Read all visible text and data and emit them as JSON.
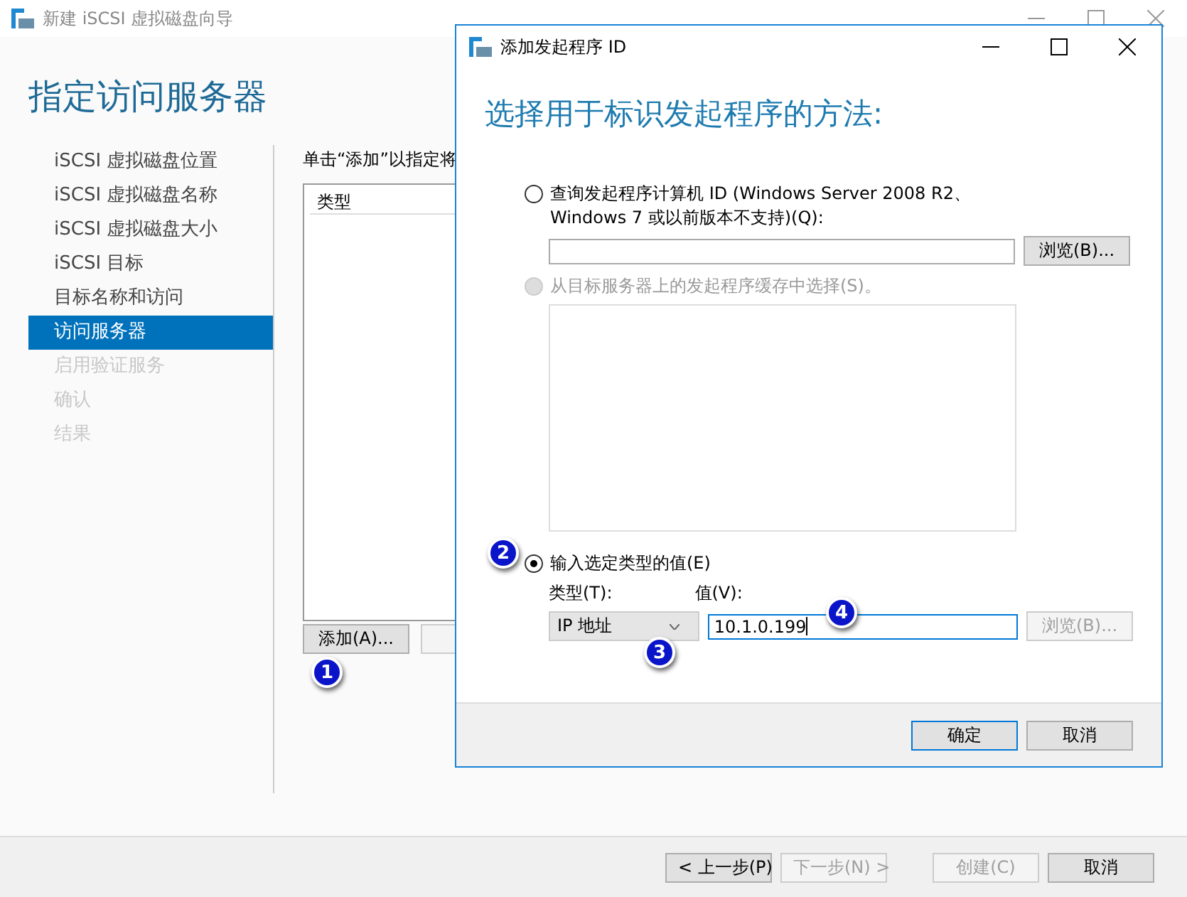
{
  "wizard": {
    "title": "新建 iSCSI 虚拟磁盘向导",
    "heading": "指定访问服务器",
    "steps": [
      {
        "label": "iSCSI 虚拟磁盘位置",
        "selected": false,
        "disabled": false
      },
      {
        "label": "iSCSI 虚拟磁盘名称",
        "selected": false,
        "disabled": false
      },
      {
        "label": "iSCSI 虚拟磁盘大小",
        "selected": false,
        "disabled": false
      },
      {
        "label": "iSCSI 目标",
        "selected": false,
        "disabled": false
      },
      {
        "label": "目标名称和访问",
        "selected": false,
        "disabled": false
      },
      {
        "label": "访问服务器",
        "selected": true,
        "disabled": false
      },
      {
        "label": "启用验证服务",
        "selected": false,
        "disabled": true
      },
      {
        "label": "确认",
        "selected": false,
        "disabled": true
      },
      {
        "label": "结果",
        "selected": false,
        "disabled": true
      }
    ],
    "instruction": "单击“添加”以指定将",
    "list": {
      "columns": [
        "类型"
      ]
    },
    "add_button": "添加(A)...",
    "nav_buttons": [
      {
        "label": "< 上一步(P)",
        "disabled": false
      },
      {
        "label": "下一步(N) >",
        "disabled": true
      },
      {
        "label": "创建(C)",
        "disabled": true
      },
      {
        "label": "取消",
        "disabled": false
      }
    ]
  },
  "dialog": {
    "title": "添加发起程序 ID",
    "heading": "选择用于标识发起程序的方法:",
    "methods": [
      {
        "kind": "query",
        "label": "查询发起程序计算机 ID (Windows Server 2008 R2、Windows 7 或以前版本不支持)(Q):",
        "selected": false,
        "disabled": false,
        "browse": "浏览(B)..."
      },
      {
        "kind": "cache",
        "label": "从目标服务器上的发起程序缓存中选择(S)。",
        "selected": false,
        "disabled": true
      },
      {
        "kind": "manual",
        "label": "输入选定类型的值(E)",
        "selected": true,
        "disabled": false,
        "type_label": "类型(T):",
        "type_value": "IP 地址",
        "value_label": "值(V):",
        "value": "10.1.0.199",
        "browse": "浏览(B)...",
        "browse_disabled": true
      }
    ],
    "buttons": [
      {
        "label": "确定",
        "default": true
      },
      {
        "label": "取消",
        "default": false
      }
    ]
  },
  "markers": [
    "1",
    "2",
    "3",
    "4"
  ]
}
